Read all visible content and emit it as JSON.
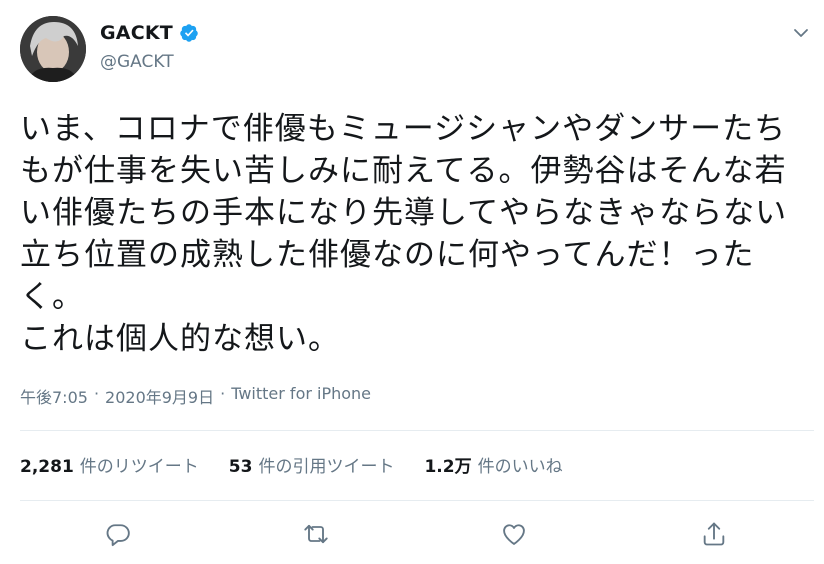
{
  "user": {
    "display_name": "GACKT",
    "handle": "@GACKT",
    "verified": true
  },
  "tweet": {
    "text": "いま、コロナで俳優もミュージシャンやダンサーたち\nもが仕事を失い苦しみに耐えてる。伊勢谷はそんな若\nい俳優たちの手本になり先導してやらなきゃならない\n立ち位置の成熟した俳優なのに何やってんだ！った\nく。\nこれは個人的な想い。",
    "time": "午後7:05",
    "separator": "·",
    "date": "2020年9月9日",
    "source": "Twitter for iPhone"
  },
  "stats": {
    "retweets": {
      "count": "2,281",
      "label": "件のリツイート"
    },
    "quotes": {
      "count": "53",
      "label": "件の引用ツイート"
    },
    "likes": {
      "count": "1.2万",
      "label": "件のいいね"
    }
  },
  "icons": {
    "verified": "verified-badge-icon",
    "menu": "chevron-down-icon",
    "reply": "reply-icon",
    "retweet": "retweet-icon",
    "like": "heart-icon",
    "share": "share-icon"
  },
  "colors": {
    "accent": "#1da1f2",
    "secondary_text": "#657786",
    "primary_text": "#14171a"
  }
}
